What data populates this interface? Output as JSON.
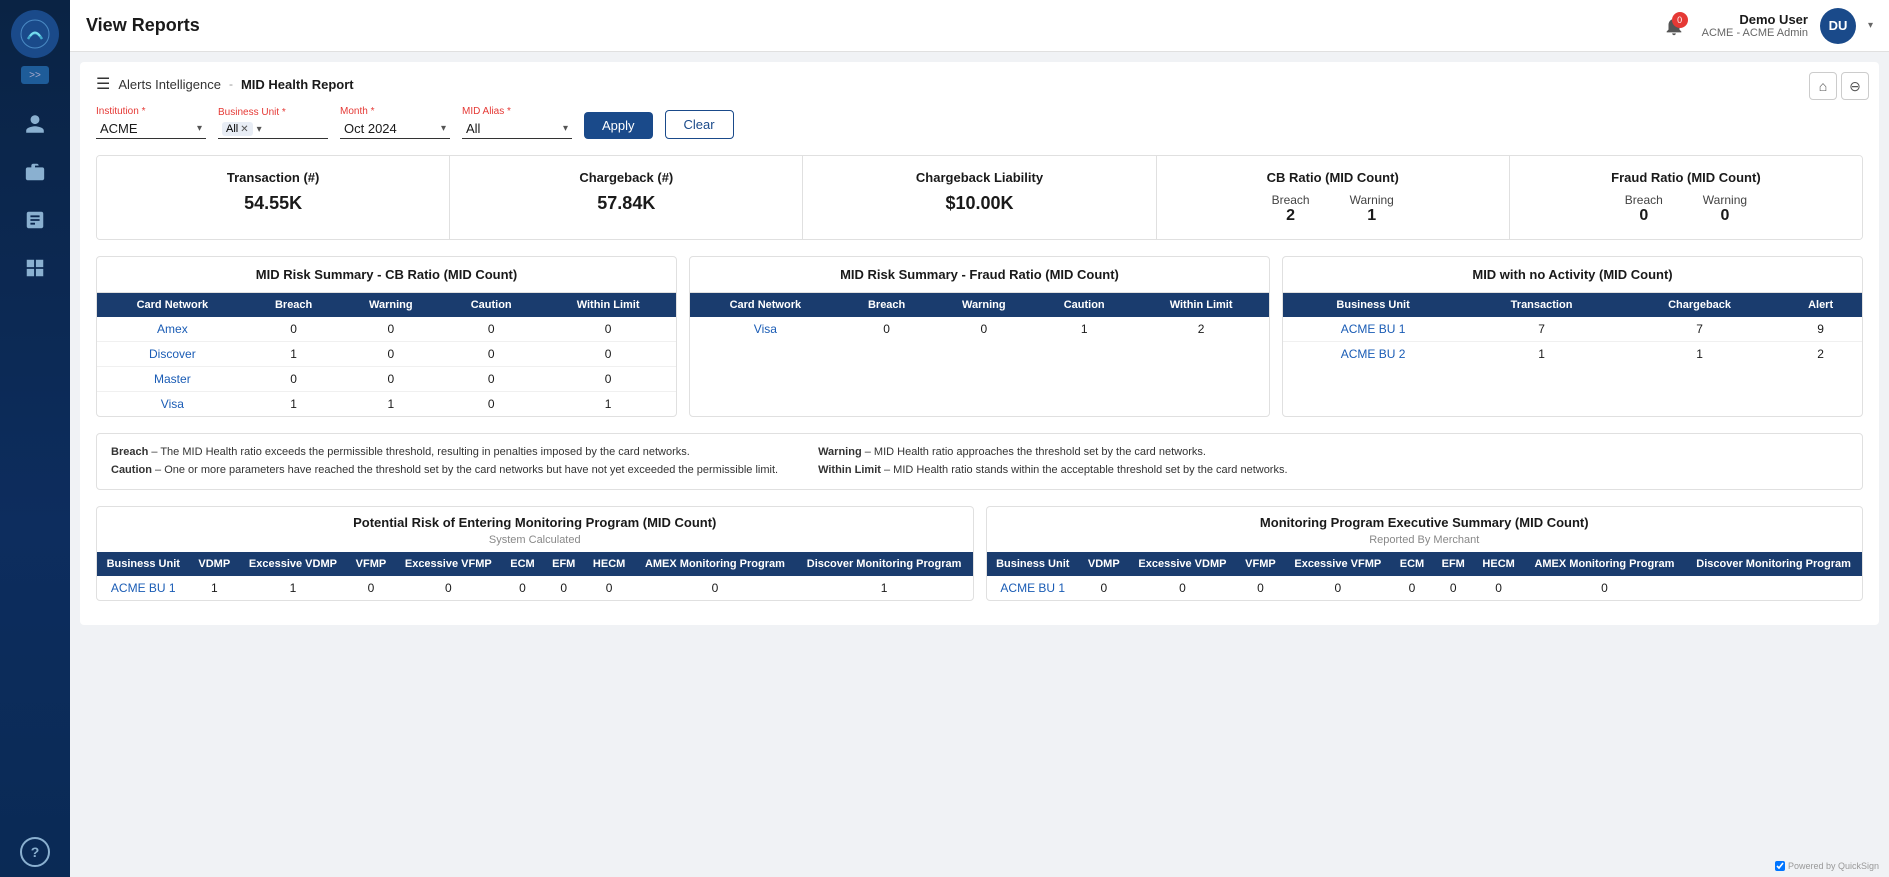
{
  "sidebar": {
    "logo_letters": "S",
    "expand_icon": ">>",
    "help_label": "?",
    "nav_items": [
      {
        "id": "users",
        "icon": "person"
      },
      {
        "id": "briefcase",
        "icon": "briefcase"
      },
      {
        "id": "reports",
        "icon": "report"
      },
      {
        "id": "grid",
        "icon": "grid"
      }
    ]
  },
  "topbar": {
    "title": "View Reports",
    "notification_count": "0",
    "user_name": "Demo User",
    "user_role": "ACME - ACME Admin",
    "user_initials": "DU"
  },
  "report": {
    "breadcrumb_parent": "Alerts Intelligence",
    "breadcrumb_sep": "-",
    "breadcrumb_current": "MID Health Report",
    "filters": {
      "institution_label": "Institution *",
      "institution_value": "ACME",
      "business_unit_label": "Business Unit *",
      "business_unit_value": "All",
      "month_label": "Month *",
      "month_value": "Oct 2024",
      "mid_alias_label": "MID Alias *",
      "mid_alias_value": "All"
    },
    "apply_btn": "Apply",
    "clear_btn": "Clear"
  },
  "kpi": {
    "cards": [
      {
        "title": "Transaction (#)",
        "value": "54.55K",
        "type": "single"
      },
      {
        "title": "Chargeback (#)",
        "value": "57.84K",
        "type": "single"
      },
      {
        "title": "Chargeback Liability",
        "value": "$10.00K",
        "type": "single"
      },
      {
        "title": "CB Ratio (MID Count)",
        "breach_label": "Breach",
        "breach_value": "2",
        "warning_label": "Warning",
        "warning_value": "1",
        "type": "dual"
      },
      {
        "title": "Fraud Ratio (MID Count)",
        "breach_label": "Breach",
        "breach_value": "0",
        "warning_label": "Warning",
        "warning_value": "0",
        "type": "dual"
      }
    ]
  },
  "cb_ratio_table": {
    "title": "MID Risk Summary - CB Ratio (MID Count)",
    "headers": [
      "Card Network",
      "Breach",
      "Warning",
      "Caution",
      "Within Limit"
    ],
    "rows": [
      [
        "Amex",
        "0",
        "0",
        "0",
        "0"
      ],
      [
        "Discover",
        "1",
        "0",
        "0",
        "0"
      ],
      [
        "Master",
        "0",
        "0",
        "0",
        "0"
      ],
      [
        "Visa",
        "1",
        "1",
        "0",
        "1"
      ]
    ]
  },
  "fraud_ratio_table": {
    "title": "MID Risk Summary - Fraud Ratio (MID Count)",
    "headers": [
      "Card Network",
      "Breach",
      "Warning",
      "Caution",
      "Within Limit"
    ],
    "rows": [
      [
        "Visa",
        "0",
        "0",
        "1",
        "2"
      ]
    ]
  },
  "no_activity_table": {
    "title": "MID with no Activity (MID Count)",
    "headers": [
      "Business Unit",
      "Transaction",
      "Chargeback",
      "Alert"
    ],
    "rows": [
      [
        "ACME BU 1",
        "7",
        "7",
        "9"
      ],
      [
        "ACME BU 2",
        "1",
        "1",
        "2"
      ]
    ]
  },
  "disclaimer": {
    "breach_title": "Breach",
    "breach_desc": "– The MID Health ratio exceeds the permissible threshold, resulting in penalties imposed by the card networks.",
    "caution_title": "Caution",
    "caution_desc": "– One or more parameters have reached the threshold set by the card networks but have not yet exceeded the permissible limit.",
    "warning_title": "Warning",
    "warning_desc": "– MID Health ratio approaches the threshold set by the card networks.",
    "within_limit_title": "Within Limit",
    "within_limit_desc": "– MID Health ratio stands within the acceptable threshold set by the card networks."
  },
  "potential_risk_table": {
    "title": "Potential Risk of Entering Monitoring Program (MID Count)",
    "subtitle": "System Calculated",
    "headers": [
      "Business Unit",
      "VDMP",
      "Excessive VDMP",
      "VFMP",
      "Excessive VFMP",
      "ECM",
      "EFM",
      "HECM",
      "AMEX Monitoring Program",
      "Discover Monitoring Program"
    ],
    "rows": [
      [
        "ACME BU 1",
        "1",
        "1",
        "0",
        "0",
        "0",
        "0",
        "0",
        "0",
        "1"
      ]
    ]
  },
  "executive_summary_table": {
    "title": "Monitoring Program Executive Summary (MID Count)",
    "subtitle": "Reported By Merchant",
    "headers": [
      "Business Unit",
      "VDMP",
      "Excessive VDMP",
      "VFMP",
      "Excessive VFMP",
      "ECM",
      "EFM",
      "HECM",
      "AMEX Monitoring Program",
      "Discover Monitoring Program"
    ],
    "rows": [
      [
        "ACME BU 1",
        "0",
        "0",
        "0",
        "0",
        "0",
        "0",
        "0",
        "0",
        ""
      ]
    ]
  },
  "powered_by": "Powered by QuickSign"
}
